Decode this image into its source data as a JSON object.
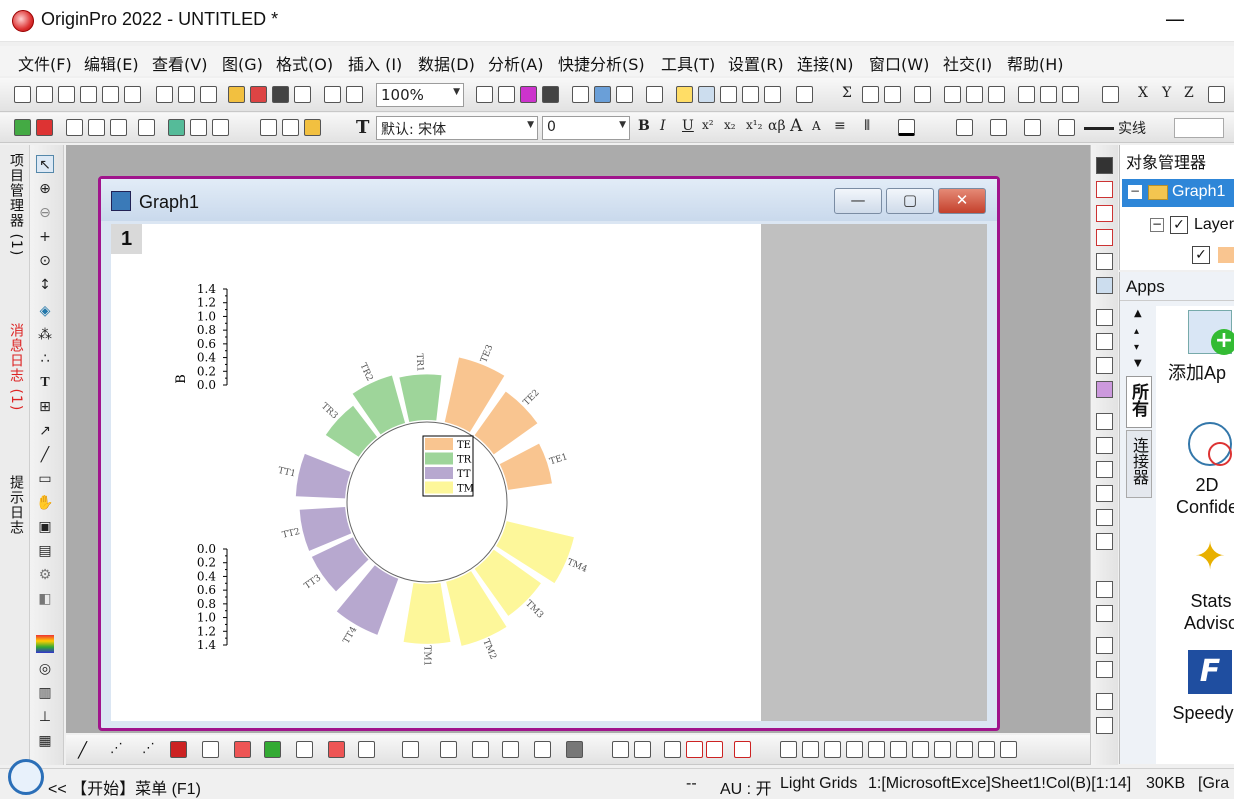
{
  "window": {
    "title": "OriginPro 2022 - UNTITLED *",
    "minimize": "—"
  },
  "menu": [
    "文件(F)",
    "编辑(E)",
    "查看(V)",
    "图(G)",
    "格式(O)",
    "插入 (I)",
    "数据(D)",
    "分析(A)",
    "快捷分析(S)",
    "工具(T)",
    "设置(R)",
    "连接(N)",
    "窗口(W)",
    "社交(I)",
    "帮助(H)"
  ],
  "toolbar": {
    "zoom": "100%",
    "font": "默认: 宋体",
    "font_size": "0",
    "line_style": "实线",
    "format_glyphs": [
      "B",
      "I",
      "U",
      "x²",
      "x₂",
      "x¹₂",
      "αβ",
      "A",
      "A",
      "≡",
      "⦀"
    ],
    "stat_glyphs": [
      "Σ",
      "X",
      "Y",
      "Z"
    ]
  },
  "left_tabs": [
    "项目管理器 (1)",
    "消息日志 (1)",
    "提示日志"
  ],
  "graph_window": {
    "title": "Graph1",
    "layer_number": "1"
  },
  "chart_data": {
    "type": "polar-bar",
    "categories": [
      "TE1",
      "TE2",
      "TE3",
      "TR1",
      "TR2",
      "TR3",
      "TT1",
      "TT2",
      "TT3",
      "TT4",
      "TM1",
      "TM2",
      "TM3",
      "TM4"
    ],
    "values": [
      0.7,
      0.85,
      1.05,
      0.72,
      0.78,
      0.62,
      0.78,
      0.72,
      0.72,
      0.95,
      0.95,
      1.05,
      0.92,
      1.1
    ],
    "groups": [
      {
        "name": "TE",
        "color": "#f9c590",
        "members": [
          "TE1",
          "TE2",
          "TE3"
        ]
      },
      {
        "name": "TR",
        "color": "#9ed59a",
        "members": [
          "TR1",
          "TR2",
          "TR3"
        ]
      },
      {
        "name": "TT",
        "color": "#b7a8cf",
        "members": [
          "TT1",
          "TT2",
          "TT3",
          "TT4"
        ]
      },
      {
        "name": "TM",
        "color": "#fdf79a",
        "members": [
          "TM1",
          "TM2",
          "TM3",
          "TM4"
        ]
      }
    ],
    "axis_top": {
      "label": "B",
      "ticks": [
        "1.4",
        "1.2",
        "1.0",
        "0.8",
        "0.6",
        "0.4",
        "0.2",
        "0.0"
      ]
    },
    "axis_bottom": {
      "ticks": [
        "0.0",
        "0.2",
        "0.4",
        "0.6",
        "0.8",
        "1.0",
        "1.2",
        "1.4"
      ]
    },
    "ylim": [
      0,
      1.4
    ],
    "legend": "center"
  },
  "object_manager": {
    "title": "对象管理器",
    "graph_node": "Graph1",
    "layer_node": "Layer"
  },
  "apps": {
    "title": "Apps",
    "tabs": [
      "所有",
      "连接器"
    ],
    "items": [
      {
        "label": "添加Ap"
      },
      {
        "label": "2D Confide"
      },
      {
        "label": "Stats Adviso"
      },
      {
        "label": "Speedy"
      }
    ]
  },
  "status": {
    "start": "<< 【开始】菜单 (F1)",
    "dashes": "--",
    "au": "AU : 开",
    "grids": "Light Grids",
    "col": "1:[MicrosoftExce]Sheet1!Col(B)[1:14]",
    "size": "30KB",
    "gra": "[Gra"
  }
}
